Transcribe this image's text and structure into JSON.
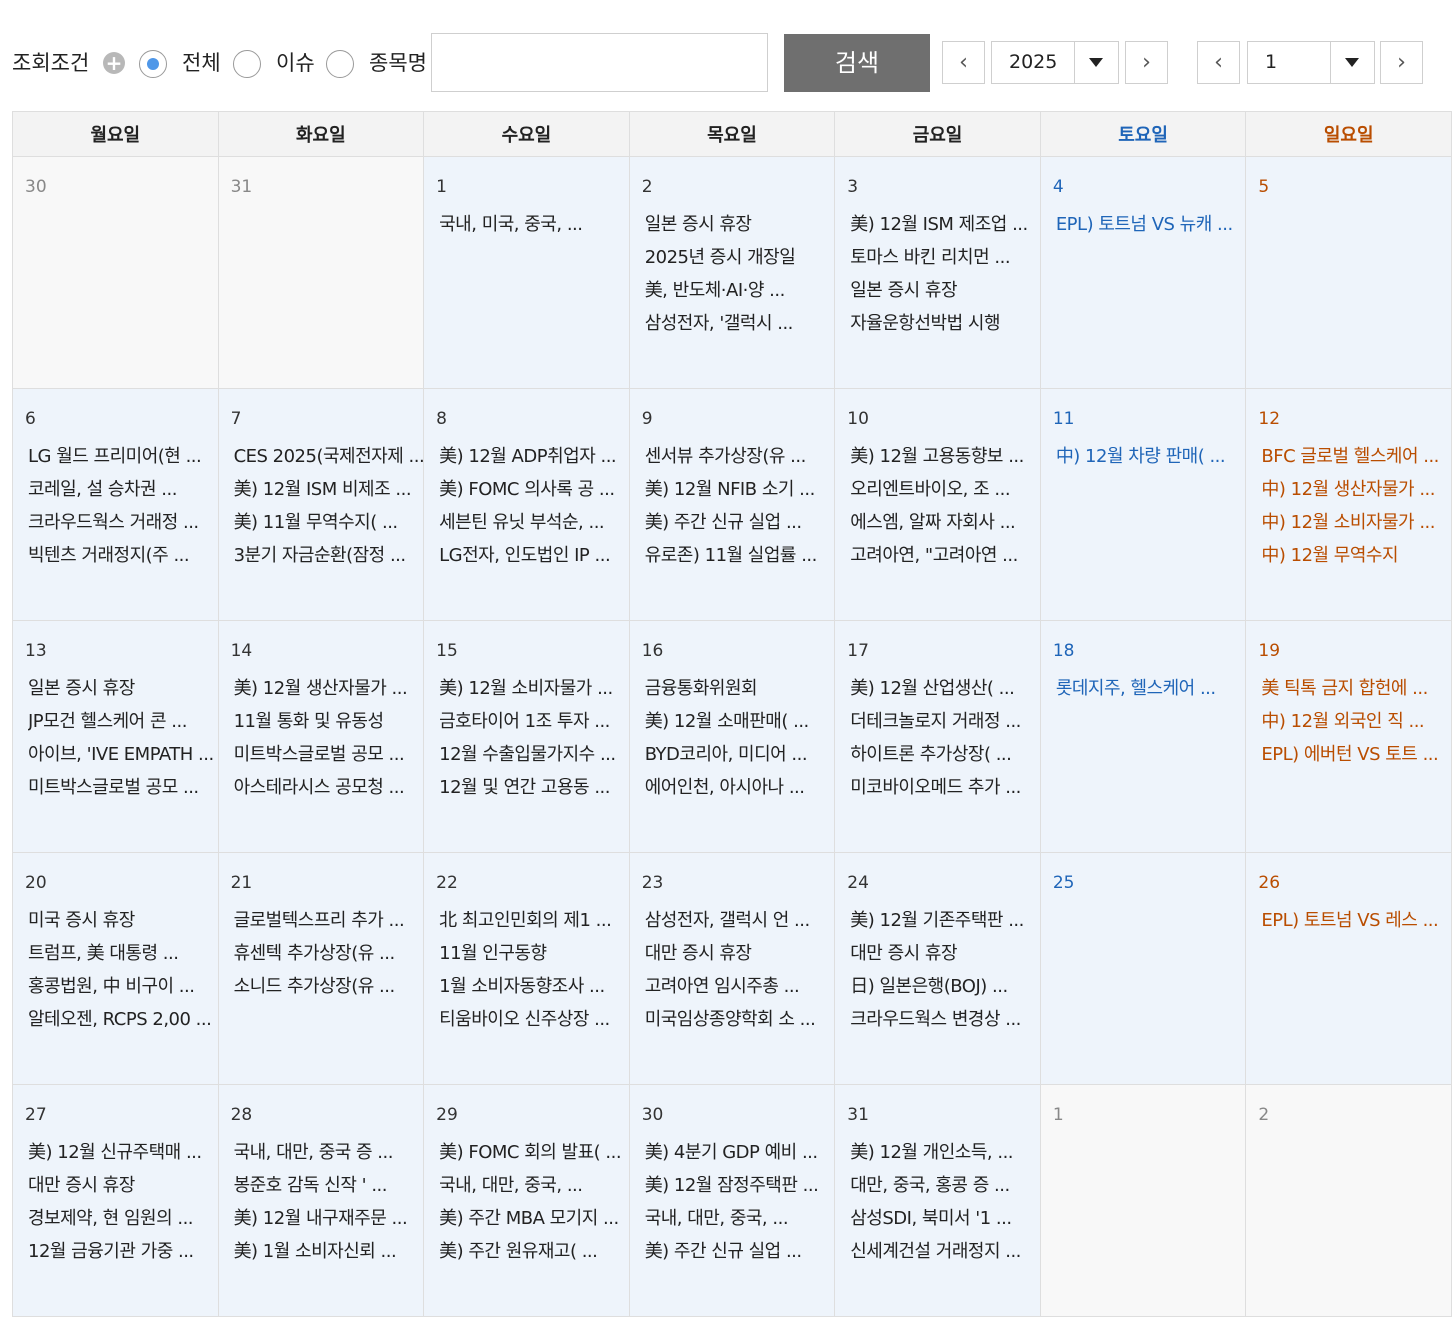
{
  "filter": {
    "label": "조회조건",
    "options": [
      "전체",
      "이슈",
      "종목명"
    ],
    "selected": "전체",
    "search_value": "",
    "search_button": "검색"
  },
  "year_nav": {
    "prev": "‹",
    "value": "2025",
    "next": "›"
  },
  "month_nav": {
    "prev": "‹",
    "value": "1",
    "next": "›"
  },
  "colors": {
    "saturday": "#1f65b8",
    "sunday": "#b94d00",
    "search_button": "#6f6f6f",
    "cell_bg": "#eef4fb",
    "radio_selected": "#4f97e8"
  },
  "calendar": {
    "weekdays": [
      "월요일",
      "화요일",
      "수요일",
      "목요일",
      "금요일",
      "토요일",
      "일요일"
    ],
    "weeks": [
      [
        {
          "day": "30",
          "events": []
        },
        {
          "day": "31",
          "events": []
        },
        {
          "day": "1",
          "events": [
            "국내, 미국, 중국, ..."
          ]
        },
        {
          "day": "2",
          "events": [
            "일본 증시 휴장",
            "2025년 증시 개장일",
            "美, 반도체·AI·양 ...",
            "삼성전자, '갤럭시 ..."
          ]
        },
        {
          "day": "3",
          "events": [
            "美) 12월 ISM 제조업 ...",
            "토마스 바킨 리치먼 ...",
            "일본 증시 휴장",
            "자율운항선박법 시행"
          ]
        },
        {
          "day": "4",
          "events": [
            "EPL) 토트넘 VS 뉴캐 ..."
          ]
        },
        {
          "day": "5",
          "events": []
        }
      ],
      [
        {
          "day": "6",
          "events": [
            "LG 월드 프리미어(현 ...",
            "코레일, 설 승차권 ...",
            "크라우드웍스 거래정 ...",
            "빅텐츠 거래정지(주 ..."
          ]
        },
        {
          "day": "7",
          "events": [
            "CES 2025(국제전자제 ...",
            "美) 12월 ISM 비제조 ...",
            "美) 11월 무역수지( ...",
            "3분기 자금순환(잠정 ..."
          ]
        },
        {
          "day": "8",
          "events": [
            "美) 12월 ADP취업자 ...",
            "美) FOMC 의사록 공 ...",
            "세븐틴 유닛 부석순, ...",
            "LG전자, 인도법인 IP ..."
          ]
        },
        {
          "day": "9",
          "events": [
            "센서뷰 추가상장(유 ...",
            "美) 12월 NFIB 소기 ...",
            "美) 주간 신규 실업 ...",
            "유로존) 11월 실업률 ..."
          ]
        },
        {
          "day": "10",
          "events": [
            "美) 12월 고용동향보 ...",
            "오리엔트바이오, 조 ...",
            "에스엠, 알짜 자회사 ...",
            "고려아연, \"고려아연 ..."
          ]
        },
        {
          "day": "11",
          "events": [
            "中) 12월 차량 판매( ..."
          ]
        },
        {
          "day": "12",
          "events": [
            "BFC 글로벌 헬스케어 ...",
            "中) 12월 생산자물가 ...",
            "中) 12월 소비자물가 ...",
            "中) 12월 무역수지"
          ]
        }
      ],
      [
        {
          "day": "13",
          "events": [
            "일본 증시 휴장",
            "JP모건 헬스케어 콘 ...",
            "아이브, 'IVE EMPATH ...",
            "미트박스글로벌 공모 ..."
          ]
        },
        {
          "day": "14",
          "events": [
            "美) 12월 생산자물가 ...",
            "11월 통화 및 유동성",
            "미트박스글로벌 공모 ...",
            "아스테라시스 공모청 ..."
          ]
        },
        {
          "day": "15",
          "events": [
            "美) 12월 소비자물가 ...",
            "금호타이어 1조 투자 ...",
            "12월 수출입물가지수 ...",
            "12월 및 연간 고용동 ..."
          ]
        },
        {
          "day": "16",
          "events": [
            "금융통화위원회",
            "美) 12월 소매판매( ...",
            "BYD코리아, 미디어 ...",
            "에어인천, 아시아나 ..."
          ]
        },
        {
          "day": "17",
          "events": [
            "美) 12월 산업생산( ...",
            "더테크놀로지 거래정 ...",
            "하이트론 추가상장( ...",
            "미코바이오메드 추가 ..."
          ]
        },
        {
          "day": "18",
          "events": [
            "롯데지주, 헬스케어 ..."
          ]
        },
        {
          "day": "19",
          "events": [
            "美 틱톡 금지 합헌에 ...",
            "中) 12월 외국인 직 ...",
            "EPL) 에버턴 VS 토트 ..."
          ]
        }
      ],
      [
        {
          "day": "20",
          "events": [
            "미국 증시 휴장",
            "트럼프, 美 대통령 ...",
            "홍콩법원, 中 비구이 ...",
            "알테오젠, RCPS 2,00 ..."
          ]
        },
        {
          "day": "21",
          "events": [
            "글로벌텍스프리 추가 ...",
            "휴센텍 추가상장(유 ...",
            "소니드 추가상장(유 ..."
          ]
        },
        {
          "day": "22",
          "events": [
            "北 최고인민회의 제1 ...",
            "11월 인구동향",
            "1월 소비자동향조사 ...",
            "티움바이오 신주상장 ..."
          ]
        },
        {
          "day": "23",
          "events": [
            "삼성전자, 갤럭시 언 ...",
            "대만 증시 휴장",
            "고려아연 임시주총 ...",
            "미국임상종양학회 소 ..."
          ]
        },
        {
          "day": "24",
          "events": [
            "美) 12월 기존주택판 ...",
            "대만 증시 휴장",
            "日) 일본은행(BOJ) ...",
            "크라우드웍스 변경상 ..."
          ]
        },
        {
          "day": "25",
          "events": []
        },
        {
          "day": "26",
          "events": [
            "EPL) 토트넘 VS 레스 ..."
          ]
        }
      ],
      [
        {
          "day": "27",
          "events": [
            "美) 12월 신규주택매 ...",
            "대만 증시 휴장",
            "경보제약, 현 임원의 ...",
            "12월 금융기관 가중 ..."
          ]
        },
        {
          "day": "28",
          "events": [
            "국내, 대만, 중국 증 ...",
            "봉준호 감독 신작 ' ...",
            "美) 12월 내구재주문 ...",
            "美) 1월 소비자신뢰 ..."
          ]
        },
        {
          "day": "29",
          "events": [
            "美) FOMC 회의 발표( ...",
            "국내, 대만, 중국, ...",
            "美) 주간 MBA 모기지 ...",
            "美) 주간 원유재고( ..."
          ]
        },
        {
          "day": "30",
          "events": [
            "美) 4분기 GDP 예비 ...",
            "美) 12월 잠정주택판 ...",
            "국내, 대만, 중국, ...",
            "美) 주간 신규 실업 ..."
          ]
        },
        {
          "day": "31",
          "events": [
            "美) 12월 개인소득, ...",
            "대만, 중국, 홍콩 증 ...",
            "삼성SDI, 북미서 '1 ...",
            "신세계건설 거래정지 ..."
          ]
        },
        {
          "day": "1",
          "events": []
        },
        {
          "day": "2",
          "events": []
        }
      ]
    ]
  }
}
